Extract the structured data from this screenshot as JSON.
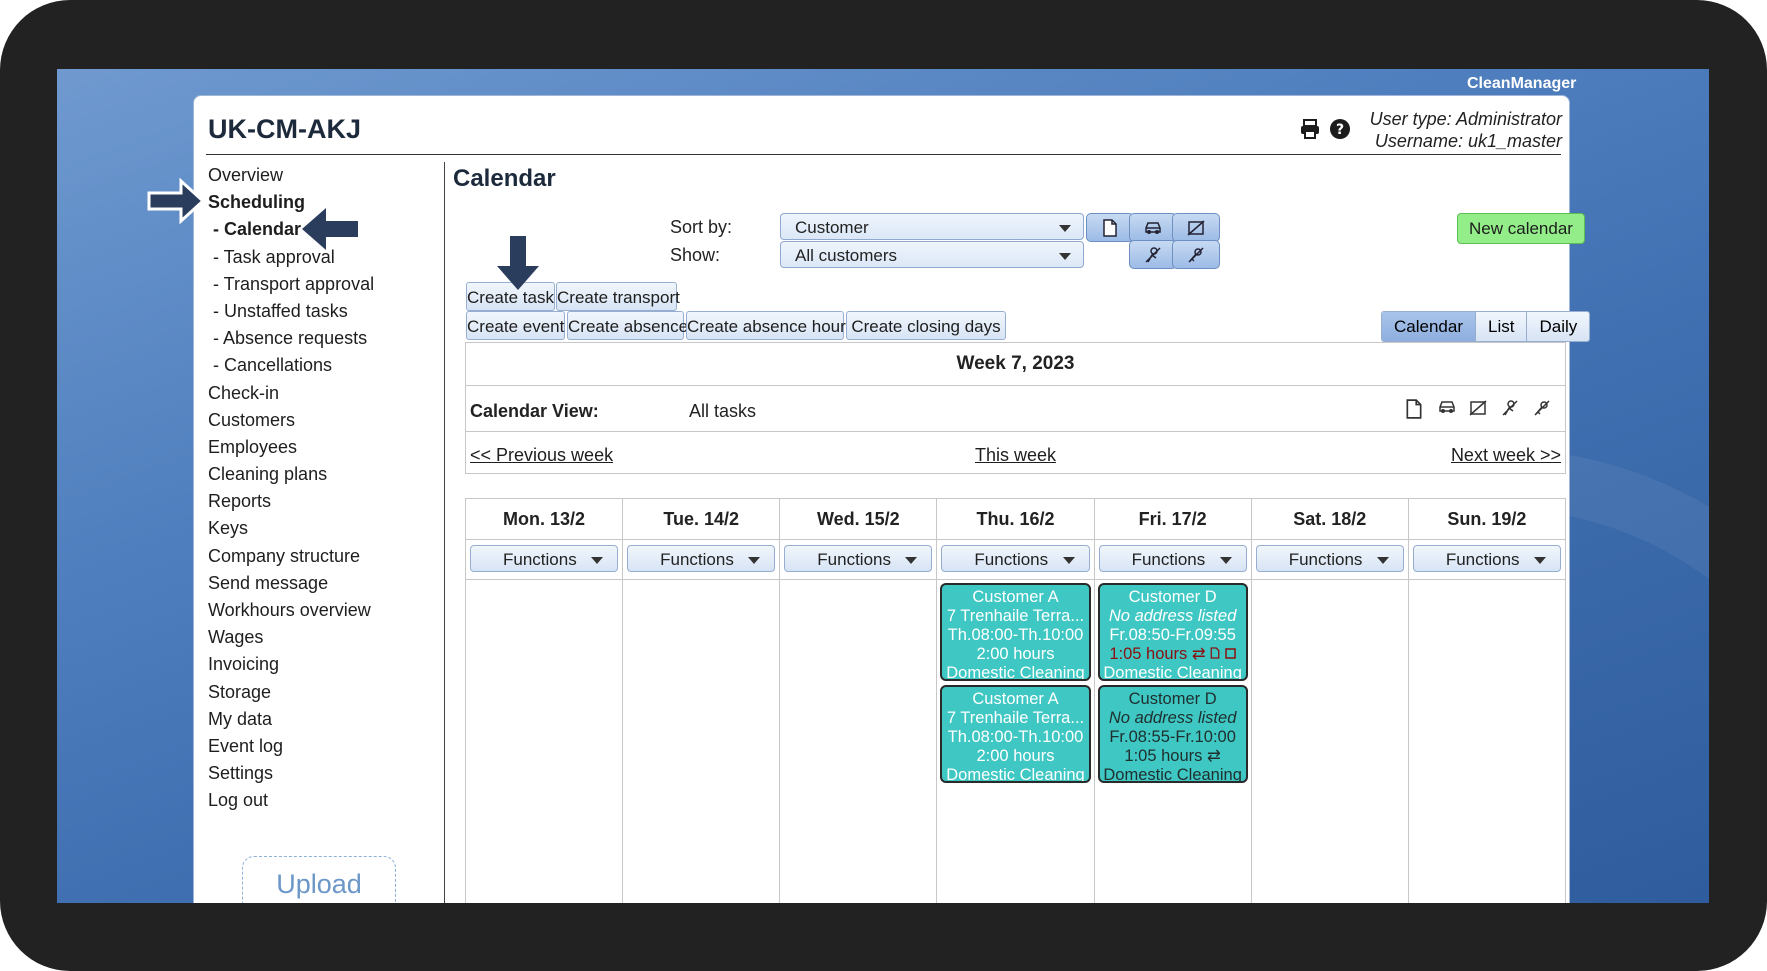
{
  "brand": "CleanManager",
  "header": {
    "title": "UK-CM-AKJ",
    "user_type": "User type: Administrator",
    "username": "Username: uk1_master"
  },
  "sidebar": {
    "items": [
      {
        "label": "Overview"
      },
      {
        "label": "Scheduling",
        "bold": true
      },
      {
        "label": "- Calendar",
        "bold": true
      },
      {
        "label": "- Task approval"
      },
      {
        "label": "- Transport approval"
      },
      {
        "label": "- Unstaffed tasks"
      },
      {
        "label": "- Absence requests"
      },
      {
        "label": "- Cancellations"
      },
      {
        "label": "Check-in"
      },
      {
        "label": "Customers"
      },
      {
        "label": "Employees"
      },
      {
        "label": "Cleaning plans"
      },
      {
        "label": "Reports"
      },
      {
        "label": "Keys"
      },
      {
        "label": "Company structure"
      },
      {
        "label": "Send message"
      },
      {
        "label": "Workhours overview"
      },
      {
        "label": "Wages"
      },
      {
        "label": "Invoicing"
      },
      {
        "label": "Storage"
      },
      {
        "label": "My data"
      },
      {
        "label": "Event log"
      },
      {
        "label": "Settings"
      },
      {
        "label": "Log out"
      }
    ],
    "upload": "Upload"
  },
  "main": {
    "title": "Calendar",
    "sort_label": "Sort by:",
    "sort_value": "Customer",
    "show_label": "Show:",
    "show_value": "All customers",
    "new_calendar": "New calendar",
    "create_task": "Create task",
    "create_transport": "Create transport",
    "create_event": "Create event",
    "create_absence": "Create absence",
    "create_absence_hours": "Create absence hours",
    "create_closing_days": "Create closing days",
    "views": [
      "Calendar",
      "List",
      "Daily"
    ],
    "week_title": "Week 7, 2023",
    "calendar_view_label": "Calendar View:",
    "calendar_view_value": "All tasks",
    "prev_week": "<< Previous week",
    "this_week": "This week",
    "next_week": "Next week >>",
    "functions_label": "Functions",
    "days": [
      "Mon. 13/2",
      "Tue. 14/2",
      "Wed. 15/2",
      "Thu. 16/2",
      "Fri. 17/2",
      "Sat. 18/2",
      "Sun. 19/2"
    ],
    "tasks": {
      "thu1": {
        "customer": "Customer A",
        "address": "7 Trenhaile Terra...",
        "time": "Th.08:00-Th.10:00",
        "hours": "2:00 hours",
        "type": "Domestic Cleaning"
      },
      "thu2": {
        "customer": "Customer A",
        "address": "7 Trenhaile Terra...",
        "time": "Th.08:00-Th.10:00",
        "hours": "2:00 hours",
        "type": "Domestic Cleaning"
      },
      "fri1": {
        "customer": "Customer D",
        "address": "No address listed",
        "time": "Fr.08:50-Fr.09:55",
        "hours": "1:05 hours",
        "type": "Domestic Cleaning"
      },
      "fri2": {
        "customer": "Customer D",
        "address": "No address listed",
        "time": "Fr.08:55-Fr.10:00",
        "hours": "1:05 hours",
        "type": "Domestic Cleaning"
      }
    }
  },
  "colors": {
    "task_bg": "#3ec7c3",
    "new_calendar_bg": "#93ee8a",
    "arrow": "#2b3d5c",
    "active_view": "#9cbbe6"
  },
  "icons": [
    "printer-icon",
    "help-icon",
    "document-icon",
    "car-icon",
    "no-document-icon",
    "no-person-icon",
    "no-key-icon",
    "swap-icon",
    "arrow-right-icon",
    "arrow-left-icon",
    "arrow-down-icon"
  ]
}
